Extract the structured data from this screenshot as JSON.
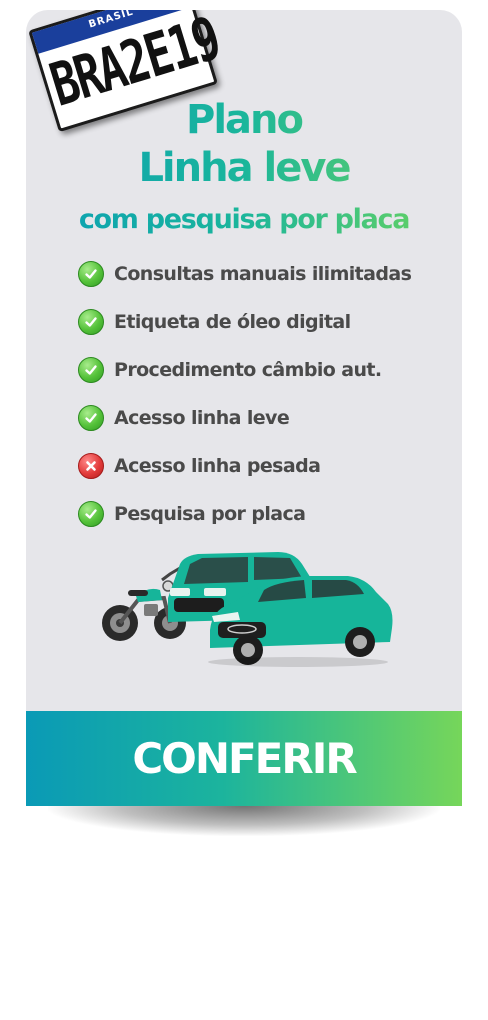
{
  "plate": {
    "country": "BRASIL",
    "number": "BRA2E19"
  },
  "header": {
    "title_line_1": "Plano",
    "title_line_2": "Linha leve",
    "subtitle": "com pesquisa por placa"
  },
  "features": [
    {
      "label": "Consultas manuais ilimitadas",
      "included": true,
      "icon": "check-icon"
    },
    {
      "label": "Etiqueta de óleo digital",
      "included": true,
      "icon": "check-icon"
    },
    {
      "label": "Procedimento câmbio aut.",
      "included": true,
      "icon": "check-icon"
    },
    {
      "label": "Acesso linha leve",
      "included": true,
      "icon": "check-icon"
    },
    {
      "label": "Acesso linha pesada",
      "included": false,
      "icon": "x-icon"
    },
    {
      "label": "Pesquisa por placa",
      "included": true,
      "icon": "check-icon"
    }
  ],
  "cta": {
    "label": "CONFERIR"
  },
  "colors": {
    "card_bg": "#e6e6ea",
    "gradient_start": "#0a9ab6",
    "gradient_mid": "#1cb49d",
    "gradient_end": "#76d65a",
    "vehicle_teal": "#16b59a",
    "check_green": "#55c23a",
    "cross_red": "#e23b3b",
    "feature_text": "#4a4a4a"
  }
}
